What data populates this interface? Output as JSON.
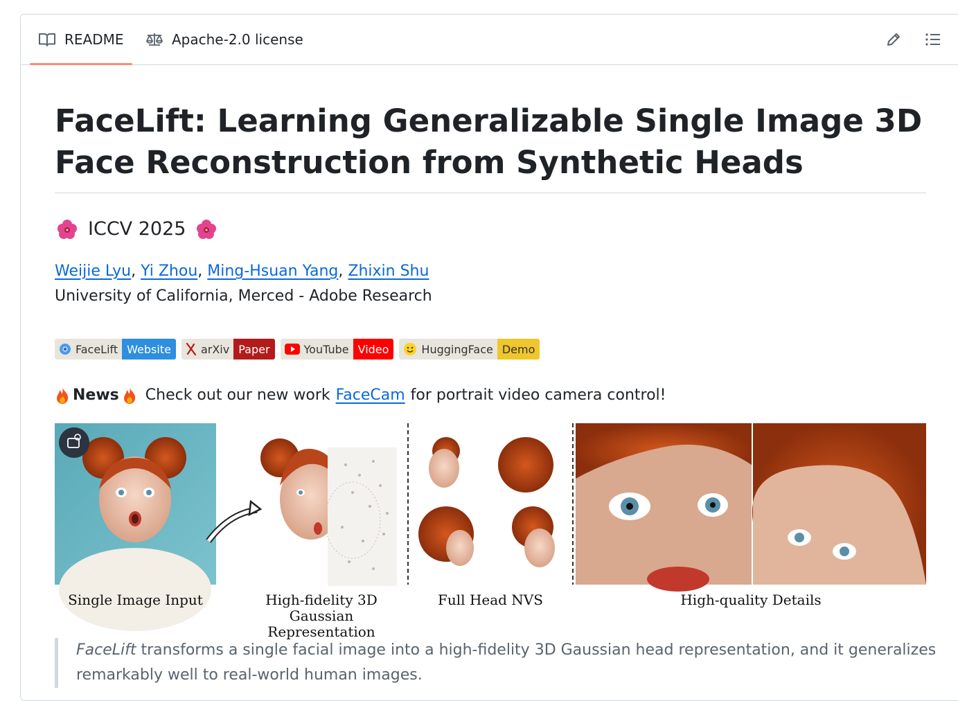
{
  "tabs": {
    "readme": "README",
    "license": "Apache-2.0 license"
  },
  "icons": {
    "readme": "book-icon",
    "license": "law-scale-icon",
    "edit": "pencil-icon",
    "outline": "list-unordered-icon",
    "copy_image": "image-search-icon"
  },
  "readme": {
    "title": "FaceLift: Learning Generalizable Single Image 3D Face Reconstruction from Synthetic Heads",
    "conference": "ICCV 2025",
    "authors": [
      "Weijie Lyu",
      "Yi Zhou",
      "Ming-Hsuan Yang",
      "Zhixin Shu"
    ],
    "affiliation": "University of California, Merced - Adobe Research",
    "badges": [
      {
        "left": "FaceLift",
        "right": "Website",
        "color": "#2e8ee0"
      },
      {
        "left": "arXiv",
        "right": "Paper",
        "color": "#b31b1b"
      },
      {
        "left": "YouTube",
        "right": "Video",
        "color": "#ff0000"
      },
      {
        "left": "HuggingFace",
        "right": "Demo",
        "color": "#efc62b"
      }
    ],
    "news": {
      "label": "News",
      "pre": "Check out our new work",
      "link": "FaceCam",
      "post": "for portrait video camera control!"
    },
    "figure_captions": {
      "input": "Single Image Input",
      "gaussian": "High-fidelity 3D Gaussian Representation",
      "nvs": "Full Head NVS",
      "details": "High-quality Details"
    },
    "quote": {
      "em": "FaceLift",
      "text": "transforms a single facial image into a high-fidelity 3D Gaussian head representation, and it generalizes remarkably well to real-world human images."
    }
  }
}
